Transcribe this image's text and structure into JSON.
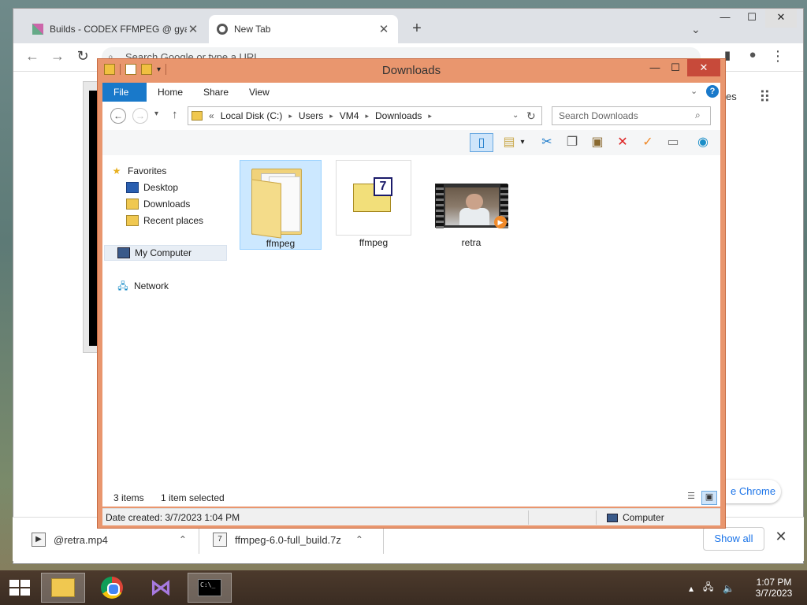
{
  "chrome": {
    "tabs": [
      {
        "label": "Builds - CODEX FFMPEG @ gyan.dev",
        "close": "✕"
      },
      {
        "label": "New Tab",
        "close": "✕"
      }
    ],
    "new_tab": "+",
    "tab_search": "⌄",
    "omnibox_placeholder": "Search Google or type a URL",
    "side_text": "es",
    "customize_text": "e Chrome"
  },
  "downloads": {
    "items": [
      {
        "name": "@retra.mp4",
        "icon": "video-file-icon"
      },
      {
        "name": "ffmpeg-6.0-full_build.7z",
        "icon": "archive-file-icon"
      }
    ],
    "show_all": "Show all",
    "close": "✕"
  },
  "explorer": {
    "title": "Downloads",
    "ribbon_tabs": [
      "File",
      "Home",
      "Share",
      "View"
    ],
    "breadcrumb": {
      "prefix": "«",
      "parts": [
        "Local Disk (C:)",
        "Users",
        "VM4",
        "Downloads"
      ]
    },
    "search_placeholder": "Search Downloads",
    "nav_pane": {
      "favorites": "Favorites",
      "favorites_items": [
        "Desktop",
        "Downloads",
        "Recent places"
      ],
      "computer": "My Computer",
      "network": "Network"
    },
    "files": [
      {
        "name": "ffmpeg",
        "type": "folder",
        "selected": true
      },
      {
        "name": "ffmpeg",
        "type": "7z-archive",
        "selected": false
      },
      {
        "name": "retra",
        "type": "video",
        "selected": false
      }
    ],
    "status": {
      "count": "3 items",
      "selection": "1 item selected"
    },
    "details": {
      "date_created": "Date created: 3/7/2023 1:04 PM",
      "location": "Computer"
    }
  },
  "taskbar": {
    "apps": [
      "file-explorer",
      "google-chrome",
      "visual-studio",
      "command-prompt"
    ],
    "cmd_glyph": "C:\\_",
    "time": "1:07 PM",
    "date": "3/7/2023"
  },
  "colors": {
    "explorer_frame": "#e9966e",
    "file_tab": "#1979ca",
    "selection": "#cce8ff",
    "close_button": "#c74a3a"
  }
}
